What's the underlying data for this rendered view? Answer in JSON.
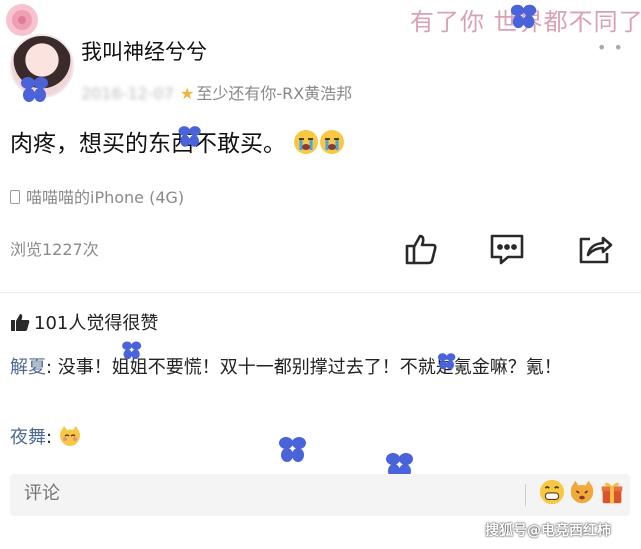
{
  "banner": {
    "text": "有了你 世界都不同了"
  },
  "post": {
    "username": "我叫神经兮兮",
    "date_blurred": "2016-12-07",
    "tag": "至少还有你-RX黄浩邦",
    "text": "肉疼，想买的东西不敢买。",
    "emojis": [
      "crying-face",
      "crying-face"
    ],
    "device": "喵喵喵的iPhone (4G)",
    "views": "浏览1227次"
  },
  "likes": {
    "text": "101人觉得很赞"
  },
  "comments": [
    {
      "author": "解夏",
      "sep": ": ",
      "text": "没事！姐姐不要慌！双十一都别撑过去了！不就是氪金嘛？氪！"
    },
    {
      "author": "夜舞",
      "sep": ": ",
      "emoji": "shy-cat-face"
    }
  ],
  "comment_bar": {
    "placeholder": "评论"
  },
  "watermark": {
    "text": "搜狐号@电竞西红柿"
  },
  "colors": {
    "author_link": "#4f6a92",
    "banner_pink": "#d9a0b6",
    "flower_blue": "#4a63d9"
  }
}
